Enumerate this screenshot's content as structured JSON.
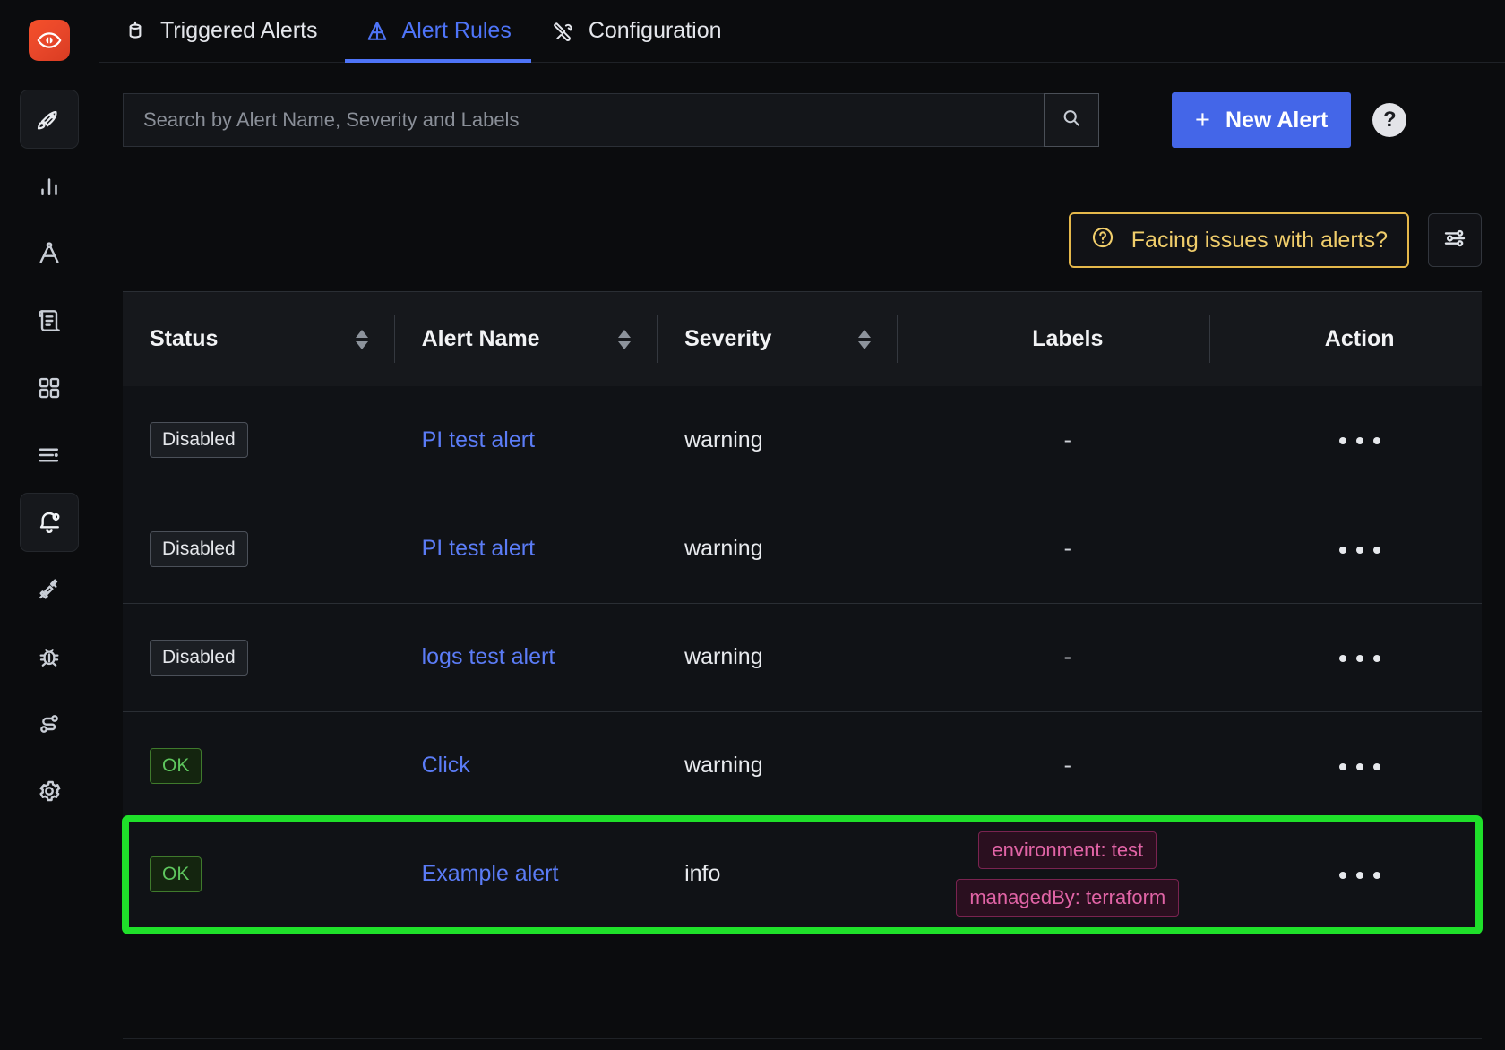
{
  "sidebar": {
    "logo_name": "signoz-logo-eye-icon",
    "items": [
      {
        "name": "get-started",
        "icon": "rocket-icon",
        "active": true
      },
      {
        "name": "services",
        "icon": "bar-chart-icon",
        "active": false
      },
      {
        "name": "traces",
        "icon": "compass-icon",
        "active": false
      },
      {
        "name": "logs",
        "icon": "scroll-icon",
        "active": false
      },
      {
        "name": "dashboards",
        "icon": "grid-icon",
        "active": false
      },
      {
        "name": "messaging-queues",
        "icon": "list-lines-icon",
        "active": false
      },
      {
        "name": "alerts",
        "icon": "bell-icon",
        "active": true
      },
      {
        "name": "integrations",
        "icon": "plug-icon",
        "active": false
      },
      {
        "name": "exceptions",
        "icon": "bug-icon",
        "active": false
      },
      {
        "name": "service-map",
        "icon": "route-icon",
        "active": false
      },
      {
        "name": "settings",
        "icon": "gear-icon",
        "active": false
      }
    ]
  },
  "tabs": [
    {
      "label": "Triggered Alerts",
      "icon": "triggered-alerts-icon",
      "active": false
    },
    {
      "label": "Alert Rules",
      "icon": "alert-rules-triangle-icon",
      "active": true
    },
    {
      "label": "Configuration",
      "icon": "configuration-tools-icon",
      "active": false
    }
  ],
  "search": {
    "placeholder": "Search by Alert Name, Severity and Labels",
    "value": "",
    "search_icon": "search-icon"
  },
  "toolbar": {
    "new_alert_label": "New Alert",
    "new_alert_plus": "+",
    "help_label": "?",
    "facing_issues_label": "Facing issues with alerts?",
    "facing_issues_icon": "question-circle-icon",
    "filter_icon": "sliders-filter-icon"
  },
  "colors": {
    "accent_blue": "#4466e8",
    "link_blue": "#5b7cf6",
    "warning_yellow": "#f0cd6b",
    "ok_green": "#5ec65e",
    "highlight_green": "#1fe02a",
    "label_pink": "#e164a6",
    "brand_orange": "#f5502a"
  },
  "table": {
    "columns": [
      {
        "key": "status",
        "label": "Status",
        "sortable": true
      },
      {
        "key": "name",
        "label": "Alert Name",
        "sortable": true
      },
      {
        "key": "severity",
        "label": "Severity",
        "sortable": true
      },
      {
        "key": "labels",
        "label": "Labels",
        "sortable": false
      },
      {
        "key": "action",
        "label": "Action",
        "sortable": false
      }
    ],
    "rows": [
      {
        "status": "Disabled",
        "status_kind": "disabled",
        "name": "PI test alert",
        "severity": "warning",
        "labels": [],
        "labels_placeholder": "-",
        "action": "more-actions",
        "highlighted": false
      },
      {
        "status": "Disabled",
        "status_kind": "disabled",
        "name": "PI test alert",
        "severity": "warning",
        "labels": [],
        "labels_placeholder": "-",
        "action": "more-actions",
        "highlighted": false
      },
      {
        "status": "Disabled",
        "status_kind": "disabled",
        "name": "logs test alert",
        "severity": "warning",
        "labels": [],
        "labels_placeholder": "-",
        "action": "more-actions",
        "highlighted": false
      },
      {
        "status": "OK",
        "status_kind": "ok",
        "name": "Click",
        "severity": "warning",
        "labels": [],
        "labels_placeholder": "-",
        "action": "more-actions",
        "highlighted": false
      },
      {
        "status": "OK",
        "status_kind": "ok",
        "name": "Example alert",
        "severity": "info",
        "labels": [
          "environment: test",
          "managedBy: terraform"
        ],
        "labels_placeholder": "",
        "action": "more-actions",
        "highlighted": true
      }
    ]
  }
}
